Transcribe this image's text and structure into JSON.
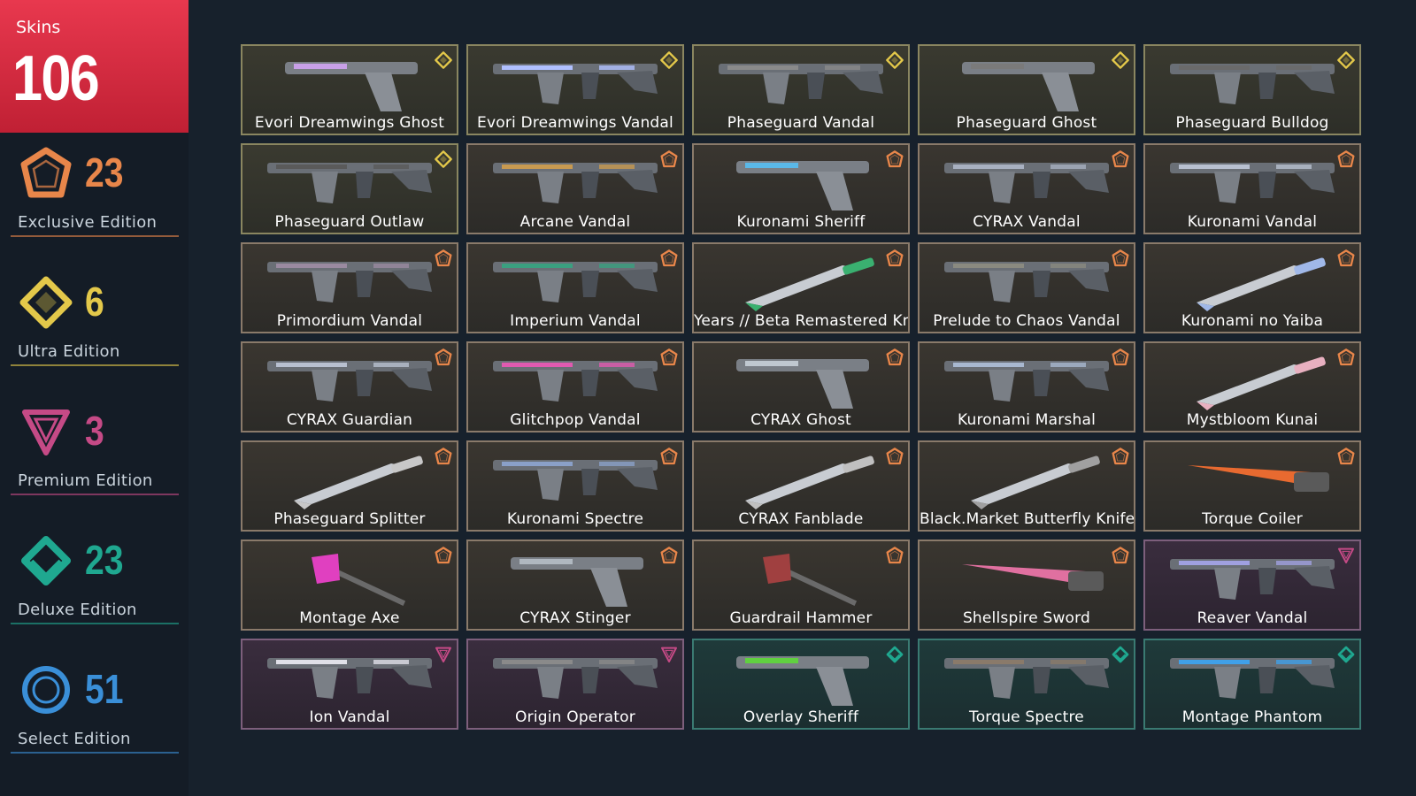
{
  "summary": {
    "label": "Skins",
    "total": "106"
  },
  "colors": {
    "exclusive": "#e8864a",
    "ultra": "#e3c84a",
    "premium": "#c54a86",
    "deluxe": "#1fa890",
    "select": "#3a8fd8"
  },
  "tiers": [
    {
      "key": "exclusive",
      "count": "23",
      "name": "Exclusive Edition",
      "icon": "exclusive-pentagon-icon"
    },
    {
      "key": "ultra",
      "count": "6",
      "name": "Ultra Edition",
      "icon": "ultra-diamond-icon"
    },
    {
      "key": "premium",
      "count": "3",
      "name": "Premium Edition",
      "icon": "premium-triangle-icon"
    },
    {
      "key": "deluxe",
      "count": "23",
      "name": "Deluxe Edition",
      "icon": "deluxe-rhombus-icon"
    },
    {
      "key": "select",
      "count": "51",
      "name": "Select Edition",
      "icon": "select-circle-icon"
    }
  ],
  "skins": [
    {
      "name": "Evori Dreamwings Ghost",
      "tier": "ultra"
    },
    {
      "name": "Evori Dreamwings Vandal",
      "tier": "ultra"
    },
    {
      "name": "Phaseguard Vandal",
      "tier": "ultra"
    },
    {
      "name": "Phaseguard Ghost",
      "tier": "ultra"
    },
    {
      "name": "Phaseguard Bulldog",
      "tier": "ultra"
    },
    {
      "name": "Phaseguard Outlaw",
      "tier": "ultra"
    },
    {
      "name": "Arcane Vandal",
      "tier": "exclusive"
    },
    {
      "name": "Kuronami Sheriff",
      "tier": "exclusive"
    },
    {
      "name": "CYRAX Vandal",
      "tier": "exclusive"
    },
    {
      "name": "Kuronami Vandal",
      "tier": "exclusive"
    },
    {
      "name": "Primordium Vandal",
      "tier": "exclusive"
    },
    {
      "name": "Imperium Vandal",
      "tier": "exclusive"
    },
    {
      "name": "Years // Beta Remastered Kni",
      "tier": "exclusive"
    },
    {
      "name": "Prelude to Chaos Vandal",
      "tier": "exclusive"
    },
    {
      "name": "Kuronami no Yaiba",
      "tier": "exclusive"
    },
    {
      "name": "CYRAX Guardian",
      "tier": "exclusive"
    },
    {
      "name": "Glitchpop Vandal",
      "tier": "exclusive"
    },
    {
      "name": "CYRAX Ghost",
      "tier": "exclusive"
    },
    {
      "name": "Kuronami Marshal",
      "tier": "exclusive"
    },
    {
      "name": "Mystbloom Kunai",
      "tier": "exclusive"
    },
    {
      "name": "Phaseguard Splitter",
      "tier": "exclusive"
    },
    {
      "name": "Kuronami Spectre",
      "tier": "exclusive"
    },
    {
      "name": "CYRAX Fanblade",
      "tier": "exclusive"
    },
    {
      "name": "Black.Market Butterfly Knife",
      "tier": "exclusive"
    },
    {
      "name": "Torque Coiler",
      "tier": "exclusive"
    },
    {
      "name": "Montage Axe",
      "tier": "exclusive"
    },
    {
      "name": "CYRAX Stinger",
      "tier": "exclusive"
    },
    {
      "name": "Guardrail Hammer",
      "tier": "exclusive"
    },
    {
      "name": "Shellspire Sword",
      "tier": "exclusive"
    },
    {
      "name": "Reaver Vandal",
      "tier": "premium"
    },
    {
      "name": "Ion Vandal",
      "tier": "premium"
    },
    {
      "name": "Origin Operator",
      "tier": "premium"
    },
    {
      "name": "Overlay Sheriff",
      "tier": "deluxe"
    },
    {
      "name": "Torque Spectre",
      "tier": "deluxe"
    },
    {
      "name": "Montage Phantom",
      "tier": "deluxe"
    }
  ]
}
